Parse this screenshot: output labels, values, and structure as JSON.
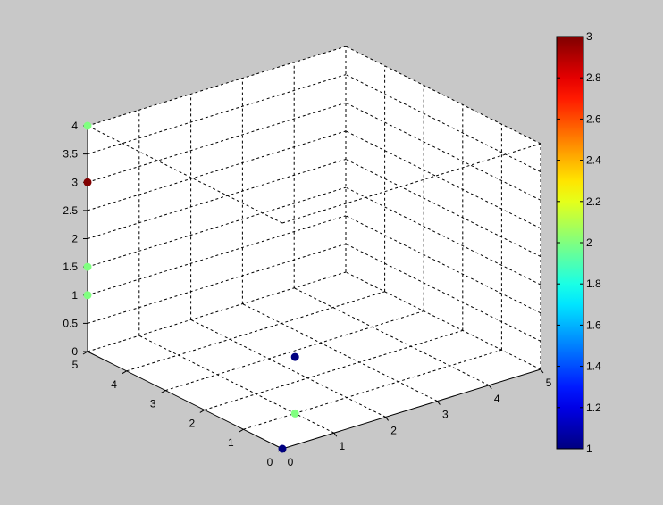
{
  "chart_data": {
    "type": "scatter3d",
    "title": "",
    "xlabel": "",
    "ylabel": "",
    "zlabel": "",
    "xlim": [
      0,
      5
    ],
    "ylim": [
      0,
      5
    ],
    "zlim": [
      0,
      4
    ],
    "x_ticks": [
      "0",
      "1",
      "2",
      "3",
      "4",
      "5"
    ],
    "y_ticks": [
      "0",
      "1",
      "2",
      "3",
      "4",
      "5"
    ],
    "z_ticks": [
      "0",
      "0.5",
      "1",
      "1.5",
      "2",
      "2.5",
      "3",
      "3.5",
      "4"
    ],
    "grid": true,
    "box": true,
    "points": [
      {
        "x": 0,
        "y": 0,
        "z": 0,
        "c": 1
      },
      {
        "x": 1,
        "y": 1,
        "z": 1,
        "c": 1
      },
      {
        "x": 1,
        "y": 1,
        "z": 0,
        "c": 2
      },
      {
        "x": 0,
        "y": 5,
        "z": 1,
        "c": 2
      },
      {
        "x": 0,
        "y": 5,
        "z": 1.5,
        "c": 2
      },
      {
        "x": 0,
        "y": 5,
        "z": 4,
        "c": 2
      },
      {
        "x": 0,
        "y": 5,
        "z": 3,
        "c": 3
      }
    ],
    "colorbar": {
      "colormap": "jet",
      "clim": [
        1,
        3
      ],
      "ticks": [
        "1",
        "1.2",
        "1.4",
        "1.6",
        "1.8",
        "2",
        "2.2",
        "2.4",
        "2.6",
        "2.8",
        "3"
      ]
    },
    "colors": {
      "background": "#c8c8c8",
      "axes_background": "#ffffff"
    }
  }
}
